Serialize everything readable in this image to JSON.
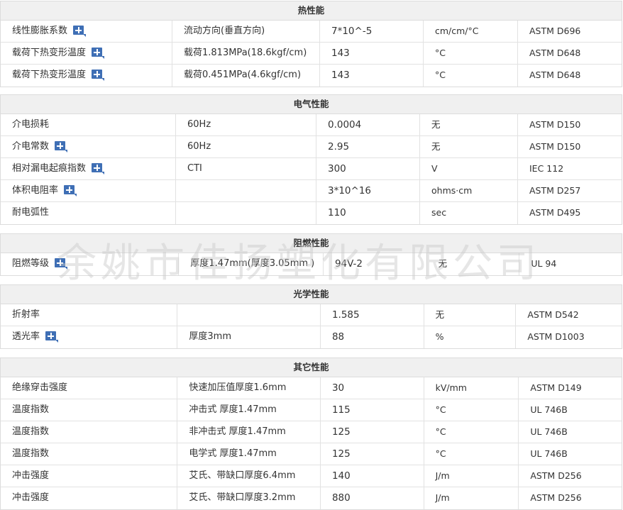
{
  "watermark": "余姚市佳扬塑化有限公司",
  "sections": [
    {
      "title": "热性能",
      "cols": [
        242,
        208,
        146,
        133,
        146
      ],
      "rows": [
        {
          "prop": "线性膨胀系数",
          "plus": true,
          "cond": "流动方向(垂直方向)",
          "value": "7*10^-5",
          "unit": "cm/cm/°C",
          "std": "ASTM D696"
        },
        {
          "prop": "载荷下热变形温度",
          "plus": true,
          "cond": "载荷1.813MPa(18.6kgf/cm)",
          "value": "143",
          "unit": "°C",
          "std": "ASTM D648"
        },
        {
          "prop": "载荷下热变形温度",
          "plus": true,
          "cond": "载荷0.451MPa(4.6kgf/cm)",
          "value": "143",
          "unit": "°C",
          "std": "ASTM D648"
        }
      ]
    },
    {
      "title": "电气性能",
      "cols": [
        247,
        198,
        146,
        138,
        146
      ],
      "rows": [
        {
          "prop": "介电损耗",
          "plus": false,
          "cond": "60Hz",
          "value": "0.0004",
          "unit": "无",
          "std": "ASTM D150"
        },
        {
          "prop": "介电常数",
          "plus": true,
          "cond": "60Hz",
          "value": "2.95",
          "unit": "无",
          "std": "ASTM D150"
        },
        {
          "prop": "相对漏电起痕指数",
          "plus": true,
          "cond": "CTI",
          "value": "300",
          "unit": "V",
          "std": "IEC 112"
        },
        {
          "prop": "体积电阻率",
          "plus": true,
          "cond": "",
          "value": "3*10^16",
          "unit": "ohms·cm",
          "std": "ASTM D257"
        },
        {
          "prop": "耐电弧性",
          "plus": false,
          "cond": "",
          "value": "110",
          "unit": "sec",
          "std": "ASTM D495"
        }
      ]
    },
    {
      "title": "阻燃性能",
      "cols": [
        252,
        204,
        146,
        131,
        144
      ],
      "rows": [
        {
          "prop": "阻燃等级",
          "plus": true,
          "cond": "厚度1.47mm(厚度3.05mm )",
          "value": "94V-2",
          "unit": "无",
          "std": "UL 94"
        }
      ]
    },
    {
      "title": "光学性能",
      "cols": [
        250,
        202,
        146,
        130,
        149
      ],
      "rows": [
        {
          "prop": "折射率",
          "plus": false,
          "cond": "",
          "value": "1.585",
          "unit": "无",
          "std": "ASTM D542"
        },
        {
          "prop": "透光率",
          "plus": true,
          "cond": "厚度3mm",
          "value": "88",
          "unit": "%",
          "std": "ASTM D1003"
        }
      ]
    },
    {
      "title": "其它性能",
      "cols": [
        250,
        202,
        146,
        134,
        145
      ],
      "rows": [
        {
          "prop": "绝缘穿击强度",
          "plus": false,
          "cond": "快速加压值厚度1.6mm",
          "value": "30",
          "unit": "kV/mm",
          "std": "ASTM D149"
        },
        {
          "prop": "温度指数",
          "plus": false,
          "cond": "冲击式 厚度1.47mm",
          "value": "115",
          "unit": "°C",
          "std": "UL 746B"
        },
        {
          "prop": "温度指数",
          "plus": false,
          "cond": "非冲击式 厚度1.47mm",
          "value": "125",
          "unit": "°C",
          "std": "UL 746B"
        },
        {
          "prop": "温度指数",
          "plus": false,
          "cond": "电学式 厚度1.47mm",
          "value": "125",
          "unit": "°C",
          "std": "UL 746B"
        },
        {
          "prop": "冲击强度",
          "plus": false,
          "cond": "艾氏、带缺口厚度6.4mm",
          "value": "140",
          "unit": "J/m",
          "std": "ASTM D256"
        },
        {
          "prop": "冲击强度",
          "plus": false,
          "cond": "艾氏、带缺口厚度3.2mm",
          "value": "880",
          "unit": "J/m",
          "std": "ASTM D256"
        }
      ]
    }
  ]
}
